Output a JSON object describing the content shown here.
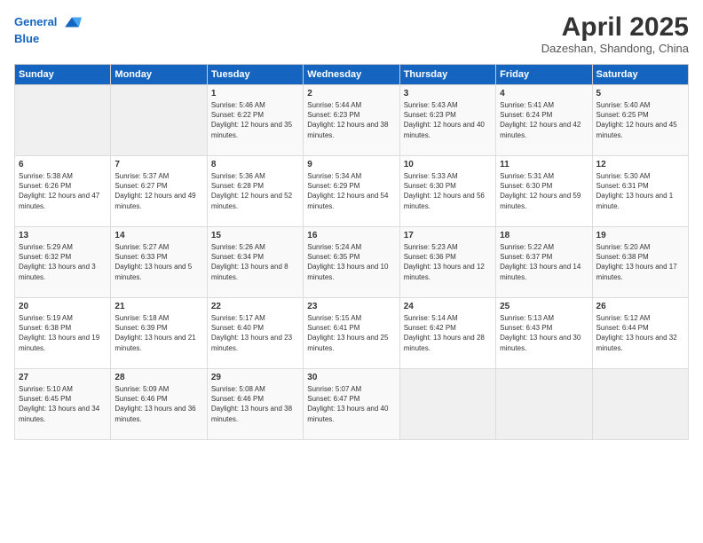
{
  "header": {
    "logo_line1": "General",
    "logo_line2": "Blue",
    "month_title": "April 2025",
    "location": "Dazeshan, Shandong, China"
  },
  "weekdays": [
    "Sunday",
    "Monday",
    "Tuesday",
    "Wednesday",
    "Thursday",
    "Friday",
    "Saturday"
  ],
  "weeks": [
    [
      {
        "day": "",
        "sunrise": "",
        "sunset": "",
        "daylight": ""
      },
      {
        "day": "",
        "sunrise": "",
        "sunset": "",
        "daylight": ""
      },
      {
        "day": "1",
        "sunrise": "Sunrise: 5:46 AM",
        "sunset": "Sunset: 6:22 PM",
        "daylight": "Daylight: 12 hours and 35 minutes."
      },
      {
        "day": "2",
        "sunrise": "Sunrise: 5:44 AM",
        "sunset": "Sunset: 6:23 PM",
        "daylight": "Daylight: 12 hours and 38 minutes."
      },
      {
        "day": "3",
        "sunrise": "Sunrise: 5:43 AM",
        "sunset": "Sunset: 6:23 PM",
        "daylight": "Daylight: 12 hours and 40 minutes."
      },
      {
        "day": "4",
        "sunrise": "Sunrise: 5:41 AM",
        "sunset": "Sunset: 6:24 PM",
        "daylight": "Daylight: 12 hours and 42 minutes."
      },
      {
        "day": "5",
        "sunrise": "Sunrise: 5:40 AM",
        "sunset": "Sunset: 6:25 PM",
        "daylight": "Daylight: 12 hours and 45 minutes."
      }
    ],
    [
      {
        "day": "6",
        "sunrise": "Sunrise: 5:38 AM",
        "sunset": "Sunset: 6:26 PM",
        "daylight": "Daylight: 12 hours and 47 minutes."
      },
      {
        "day": "7",
        "sunrise": "Sunrise: 5:37 AM",
        "sunset": "Sunset: 6:27 PM",
        "daylight": "Daylight: 12 hours and 49 minutes."
      },
      {
        "day": "8",
        "sunrise": "Sunrise: 5:36 AM",
        "sunset": "Sunset: 6:28 PM",
        "daylight": "Daylight: 12 hours and 52 minutes."
      },
      {
        "day": "9",
        "sunrise": "Sunrise: 5:34 AM",
        "sunset": "Sunset: 6:29 PM",
        "daylight": "Daylight: 12 hours and 54 minutes."
      },
      {
        "day": "10",
        "sunrise": "Sunrise: 5:33 AM",
        "sunset": "Sunset: 6:30 PM",
        "daylight": "Daylight: 12 hours and 56 minutes."
      },
      {
        "day": "11",
        "sunrise": "Sunrise: 5:31 AM",
        "sunset": "Sunset: 6:30 PM",
        "daylight": "Daylight: 12 hours and 59 minutes."
      },
      {
        "day": "12",
        "sunrise": "Sunrise: 5:30 AM",
        "sunset": "Sunset: 6:31 PM",
        "daylight": "Daylight: 13 hours and 1 minute."
      }
    ],
    [
      {
        "day": "13",
        "sunrise": "Sunrise: 5:29 AM",
        "sunset": "Sunset: 6:32 PM",
        "daylight": "Daylight: 13 hours and 3 minutes."
      },
      {
        "day": "14",
        "sunrise": "Sunrise: 5:27 AM",
        "sunset": "Sunset: 6:33 PM",
        "daylight": "Daylight: 13 hours and 5 minutes."
      },
      {
        "day": "15",
        "sunrise": "Sunrise: 5:26 AM",
        "sunset": "Sunset: 6:34 PM",
        "daylight": "Daylight: 13 hours and 8 minutes."
      },
      {
        "day": "16",
        "sunrise": "Sunrise: 5:24 AM",
        "sunset": "Sunset: 6:35 PM",
        "daylight": "Daylight: 13 hours and 10 minutes."
      },
      {
        "day": "17",
        "sunrise": "Sunrise: 5:23 AM",
        "sunset": "Sunset: 6:36 PM",
        "daylight": "Daylight: 13 hours and 12 minutes."
      },
      {
        "day": "18",
        "sunrise": "Sunrise: 5:22 AM",
        "sunset": "Sunset: 6:37 PM",
        "daylight": "Daylight: 13 hours and 14 minutes."
      },
      {
        "day": "19",
        "sunrise": "Sunrise: 5:20 AM",
        "sunset": "Sunset: 6:38 PM",
        "daylight": "Daylight: 13 hours and 17 minutes."
      }
    ],
    [
      {
        "day": "20",
        "sunrise": "Sunrise: 5:19 AM",
        "sunset": "Sunset: 6:38 PM",
        "daylight": "Daylight: 13 hours and 19 minutes."
      },
      {
        "day": "21",
        "sunrise": "Sunrise: 5:18 AM",
        "sunset": "Sunset: 6:39 PM",
        "daylight": "Daylight: 13 hours and 21 minutes."
      },
      {
        "day": "22",
        "sunrise": "Sunrise: 5:17 AM",
        "sunset": "Sunset: 6:40 PM",
        "daylight": "Daylight: 13 hours and 23 minutes."
      },
      {
        "day": "23",
        "sunrise": "Sunrise: 5:15 AM",
        "sunset": "Sunset: 6:41 PM",
        "daylight": "Daylight: 13 hours and 25 minutes."
      },
      {
        "day": "24",
        "sunrise": "Sunrise: 5:14 AM",
        "sunset": "Sunset: 6:42 PM",
        "daylight": "Daylight: 13 hours and 28 minutes."
      },
      {
        "day": "25",
        "sunrise": "Sunrise: 5:13 AM",
        "sunset": "Sunset: 6:43 PM",
        "daylight": "Daylight: 13 hours and 30 minutes."
      },
      {
        "day": "26",
        "sunrise": "Sunrise: 5:12 AM",
        "sunset": "Sunset: 6:44 PM",
        "daylight": "Daylight: 13 hours and 32 minutes."
      }
    ],
    [
      {
        "day": "27",
        "sunrise": "Sunrise: 5:10 AM",
        "sunset": "Sunset: 6:45 PM",
        "daylight": "Daylight: 13 hours and 34 minutes."
      },
      {
        "day": "28",
        "sunrise": "Sunrise: 5:09 AM",
        "sunset": "Sunset: 6:46 PM",
        "daylight": "Daylight: 13 hours and 36 minutes."
      },
      {
        "day": "29",
        "sunrise": "Sunrise: 5:08 AM",
        "sunset": "Sunset: 6:46 PM",
        "daylight": "Daylight: 13 hours and 38 minutes."
      },
      {
        "day": "30",
        "sunrise": "Sunrise: 5:07 AM",
        "sunset": "Sunset: 6:47 PM",
        "daylight": "Daylight: 13 hours and 40 minutes."
      },
      {
        "day": "",
        "sunrise": "",
        "sunset": "",
        "daylight": ""
      },
      {
        "day": "",
        "sunrise": "",
        "sunset": "",
        "daylight": ""
      },
      {
        "day": "",
        "sunrise": "",
        "sunset": "",
        "daylight": ""
      }
    ]
  ]
}
